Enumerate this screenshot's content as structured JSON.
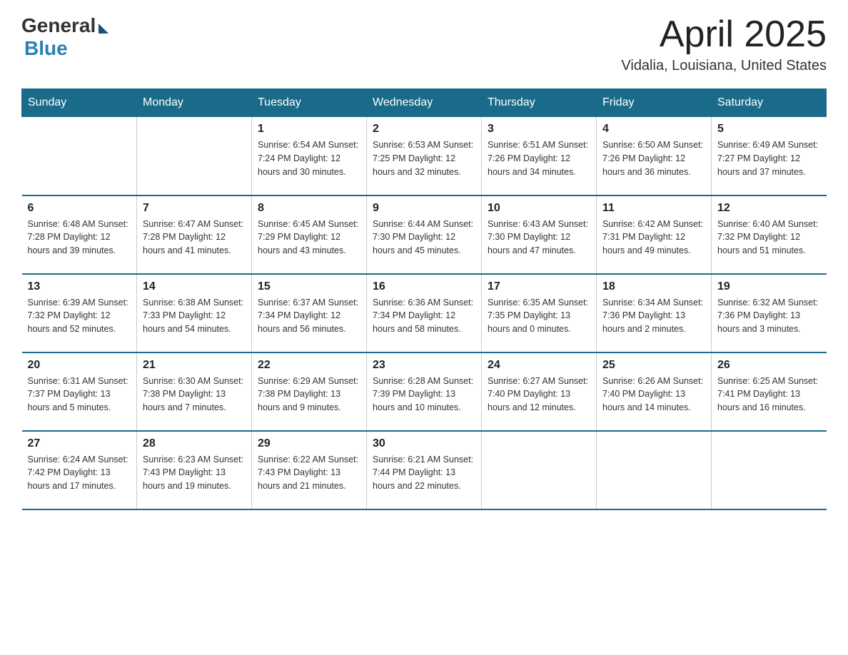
{
  "logo": {
    "general": "General",
    "blue": "Blue"
  },
  "header": {
    "month": "April 2025",
    "location": "Vidalia, Louisiana, United States"
  },
  "days_of_week": [
    "Sunday",
    "Monday",
    "Tuesday",
    "Wednesday",
    "Thursday",
    "Friday",
    "Saturday"
  ],
  "weeks": [
    [
      {
        "day": "",
        "info": ""
      },
      {
        "day": "",
        "info": ""
      },
      {
        "day": "1",
        "info": "Sunrise: 6:54 AM\nSunset: 7:24 PM\nDaylight: 12 hours\nand 30 minutes."
      },
      {
        "day": "2",
        "info": "Sunrise: 6:53 AM\nSunset: 7:25 PM\nDaylight: 12 hours\nand 32 minutes."
      },
      {
        "day": "3",
        "info": "Sunrise: 6:51 AM\nSunset: 7:26 PM\nDaylight: 12 hours\nand 34 minutes."
      },
      {
        "day": "4",
        "info": "Sunrise: 6:50 AM\nSunset: 7:26 PM\nDaylight: 12 hours\nand 36 minutes."
      },
      {
        "day": "5",
        "info": "Sunrise: 6:49 AM\nSunset: 7:27 PM\nDaylight: 12 hours\nand 37 minutes."
      }
    ],
    [
      {
        "day": "6",
        "info": "Sunrise: 6:48 AM\nSunset: 7:28 PM\nDaylight: 12 hours\nand 39 minutes."
      },
      {
        "day": "7",
        "info": "Sunrise: 6:47 AM\nSunset: 7:28 PM\nDaylight: 12 hours\nand 41 minutes."
      },
      {
        "day": "8",
        "info": "Sunrise: 6:45 AM\nSunset: 7:29 PM\nDaylight: 12 hours\nand 43 minutes."
      },
      {
        "day": "9",
        "info": "Sunrise: 6:44 AM\nSunset: 7:30 PM\nDaylight: 12 hours\nand 45 minutes."
      },
      {
        "day": "10",
        "info": "Sunrise: 6:43 AM\nSunset: 7:30 PM\nDaylight: 12 hours\nand 47 minutes."
      },
      {
        "day": "11",
        "info": "Sunrise: 6:42 AM\nSunset: 7:31 PM\nDaylight: 12 hours\nand 49 minutes."
      },
      {
        "day": "12",
        "info": "Sunrise: 6:40 AM\nSunset: 7:32 PM\nDaylight: 12 hours\nand 51 minutes."
      }
    ],
    [
      {
        "day": "13",
        "info": "Sunrise: 6:39 AM\nSunset: 7:32 PM\nDaylight: 12 hours\nand 52 minutes."
      },
      {
        "day": "14",
        "info": "Sunrise: 6:38 AM\nSunset: 7:33 PM\nDaylight: 12 hours\nand 54 minutes."
      },
      {
        "day": "15",
        "info": "Sunrise: 6:37 AM\nSunset: 7:34 PM\nDaylight: 12 hours\nand 56 minutes."
      },
      {
        "day": "16",
        "info": "Sunrise: 6:36 AM\nSunset: 7:34 PM\nDaylight: 12 hours\nand 58 minutes."
      },
      {
        "day": "17",
        "info": "Sunrise: 6:35 AM\nSunset: 7:35 PM\nDaylight: 13 hours\nand 0 minutes."
      },
      {
        "day": "18",
        "info": "Sunrise: 6:34 AM\nSunset: 7:36 PM\nDaylight: 13 hours\nand 2 minutes."
      },
      {
        "day": "19",
        "info": "Sunrise: 6:32 AM\nSunset: 7:36 PM\nDaylight: 13 hours\nand 3 minutes."
      }
    ],
    [
      {
        "day": "20",
        "info": "Sunrise: 6:31 AM\nSunset: 7:37 PM\nDaylight: 13 hours\nand 5 minutes."
      },
      {
        "day": "21",
        "info": "Sunrise: 6:30 AM\nSunset: 7:38 PM\nDaylight: 13 hours\nand 7 minutes."
      },
      {
        "day": "22",
        "info": "Sunrise: 6:29 AM\nSunset: 7:38 PM\nDaylight: 13 hours\nand 9 minutes."
      },
      {
        "day": "23",
        "info": "Sunrise: 6:28 AM\nSunset: 7:39 PM\nDaylight: 13 hours\nand 10 minutes."
      },
      {
        "day": "24",
        "info": "Sunrise: 6:27 AM\nSunset: 7:40 PM\nDaylight: 13 hours\nand 12 minutes."
      },
      {
        "day": "25",
        "info": "Sunrise: 6:26 AM\nSunset: 7:40 PM\nDaylight: 13 hours\nand 14 minutes."
      },
      {
        "day": "26",
        "info": "Sunrise: 6:25 AM\nSunset: 7:41 PM\nDaylight: 13 hours\nand 16 minutes."
      }
    ],
    [
      {
        "day": "27",
        "info": "Sunrise: 6:24 AM\nSunset: 7:42 PM\nDaylight: 13 hours\nand 17 minutes."
      },
      {
        "day": "28",
        "info": "Sunrise: 6:23 AM\nSunset: 7:43 PM\nDaylight: 13 hours\nand 19 minutes."
      },
      {
        "day": "29",
        "info": "Sunrise: 6:22 AM\nSunset: 7:43 PM\nDaylight: 13 hours\nand 21 minutes."
      },
      {
        "day": "30",
        "info": "Sunrise: 6:21 AM\nSunset: 7:44 PM\nDaylight: 13 hours\nand 22 minutes."
      },
      {
        "day": "",
        "info": ""
      },
      {
        "day": "",
        "info": ""
      },
      {
        "day": "",
        "info": ""
      }
    ]
  ]
}
